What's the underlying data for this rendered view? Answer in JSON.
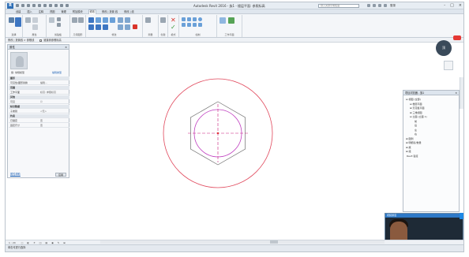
{
  "titlebar": {
    "logo": "R",
    "document_title": "Autodesk Revit 2016 - 族1 - 楼层平面: 参照标高",
    "search_placeholder": "键入关键字或短语",
    "user": "登录",
    "window_controls": [
      "-",
      "□",
      "×"
    ]
  },
  "ribbon_tabs": [
    "创建",
    "插入",
    "注释",
    "视图",
    "管理",
    "附加模块",
    "修改",
    "修改 | 放置 线",
    "修改 | 线"
  ],
  "ribbon_active_tab_index": 6,
  "ribbon_groups": [
    "选择",
    "属性",
    "剪贴板",
    "几何图形",
    "修改",
    "测量",
    "创建",
    "模式",
    "绘制",
    "工作平面"
  ],
  "options_bar": {
    "label": "修改 | 放置线 > 参照线",
    "checkbox_label": "链接到参照标高"
  },
  "properties": {
    "title": "属性",
    "close": "×",
    "type_label": "族: 常规模型",
    "edit_type": "编辑类型",
    "rows": [
      {
        "k": "图形",
        "v": "",
        "section": true
      },
      {
        "k": "可见性/图形替换",
        "v": "编辑..."
      },
      {
        "k": "范围",
        "v": "",
        "section": true
      },
      {
        "k": "工作平面",
        "v": "标高: 参照标高"
      },
      {
        "k": "其他",
        "v": "",
        "section": true
      },
      {
        "k": "可见",
        "v": "☑"
      },
      {
        "k": "标识数据",
        "v": "",
        "section": true
      },
      {
        "k": "子类别",
        "v": "<无>"
      },
      {
        "k": "约束",
        "v": "",
        "section": true
      },
      {
        "k": "已锁定",
        "v": "否"
      },
      {
        "k": "固定尺寸",
        "v": "否"
      }
    ],
    "help_link": "属性帮助",
    "apply": "应用"
  },
  "project_browser": {
    "title": "项目浏览器 - 族1",
    "close": "×",
    "nodes": [
      {
        "label": "视图 (全部)",
        "indent": 0,
        "toggle": "⊟"
      },
      {
        "label": "楼层平面",
        "indent": 1,
        "toggle": "⊟"
      },
      {
        "label": "天花板平面",
        "indent": 1,
        "toggle": "⊞"
      },
      {
        "label": "三维视图",
        "indent": 1,
        "toggle": "⊞"
      },
      {
        "label": "立面 (立面 1)",
        "indent": 1,
        "toggle": "⊟"
      },
      {
        "label": "前",
        "indent": 2,
        "toggle": ""
      },
      {
        "label": "后",
        "indent": 2,
        "toggle": ""
      },
      {
        "label": "左",
        "indent": 2,
        "toggle": ""
      },
      {
        "label": "右",
        "indent": 2,
        "toggle": ""
      },
      {
        "label": "图例",
        "indent": 0,
        "toggle": "⊞"
      },
      {
        "label": "明细表/数量",
        "indent": 0,
        "toggle": "⊞"
      },
      {
        "label": "族",
        "indent": 0,
        "toggle": "⊞"
      },
      {
        "label": "组",
        "indent": 0,
        "toggle": "⊞"
      },
      {
        "label": "Revit 链接",
        "indent": 0,
        "toggle": ""
      }
    ]
  },
  "viewcube": {
    "label": "顶"
  },
  "camera": {
    "header": "视频通话",
    "button": "全屏观看"
  },
  "view_control": {
    "scale": "1 : 20"
  },
  "statusbar": {
    "text": "单击可进行选择"
  },
  "colors": {
    "reference_line": "#c8197a",
    "outer_circle": "#e0465a",
    "inner_circle": "#c040c0",
    "hexagon": "#707070",
    "center_mark": "#e03030",
    "accent": "#2e79c7"
  }
}
